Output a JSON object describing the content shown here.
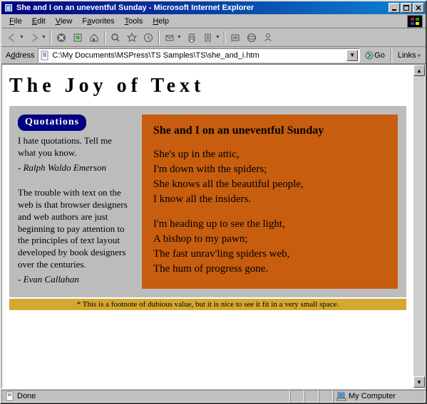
{
  "window": {
    "title": "She and I on an uneventful Sunday - Microsoft Internet Explorer"
  },
  "menu": {
    "file": "File",
    "edit": "Edit",
    "view": "View",
    "favorites": "Favorites",
    "tools": "Tools",
    "help": "Help"
  },
  "address": {
    "label": "Address",
    "value": "C:\\My Documents\\MSPress\\TS Samples\\TS\\she_and_i.htm",
    "go": "Go",
    "links": "Links"
  },
  "page": {
    "heading": "The Joy of Text",
    "sidebar": {
      "badge": "Quotations",
      "quote1": "I hate quotations. Tell me what you know.",
      "quote1_auth": "- Ralph Waldo Emerson",
      "quote2": "The trouble with text on the web is that browser designers and web authors are just beginning to pay attention to the principles of text layout developed by book designers over the centuries.",
      "quote2_auth": "- Evan Callahan"
    },
    "poem": {
      "title": "She and I on an uneventful Sunday",
      "lines": [
        "She's up in the attic,",
        "I'm down with the spiders;",
        "She knows all the beautiful people,",
        "I know all the insiders.",
        "",
        "I'm heading up to see the light,",
        "A bishop to my pawn;",
        "The fast unrav'ling spiders web,",
        "The hum of progress gone."
      ]
    },
    "footnote": "* This is a footnote of dubious value, but it is nice to see it fit in a very small space."
  },
  "status": {
    "text": "Done",
    "zone": "My Computer"
  }
}
